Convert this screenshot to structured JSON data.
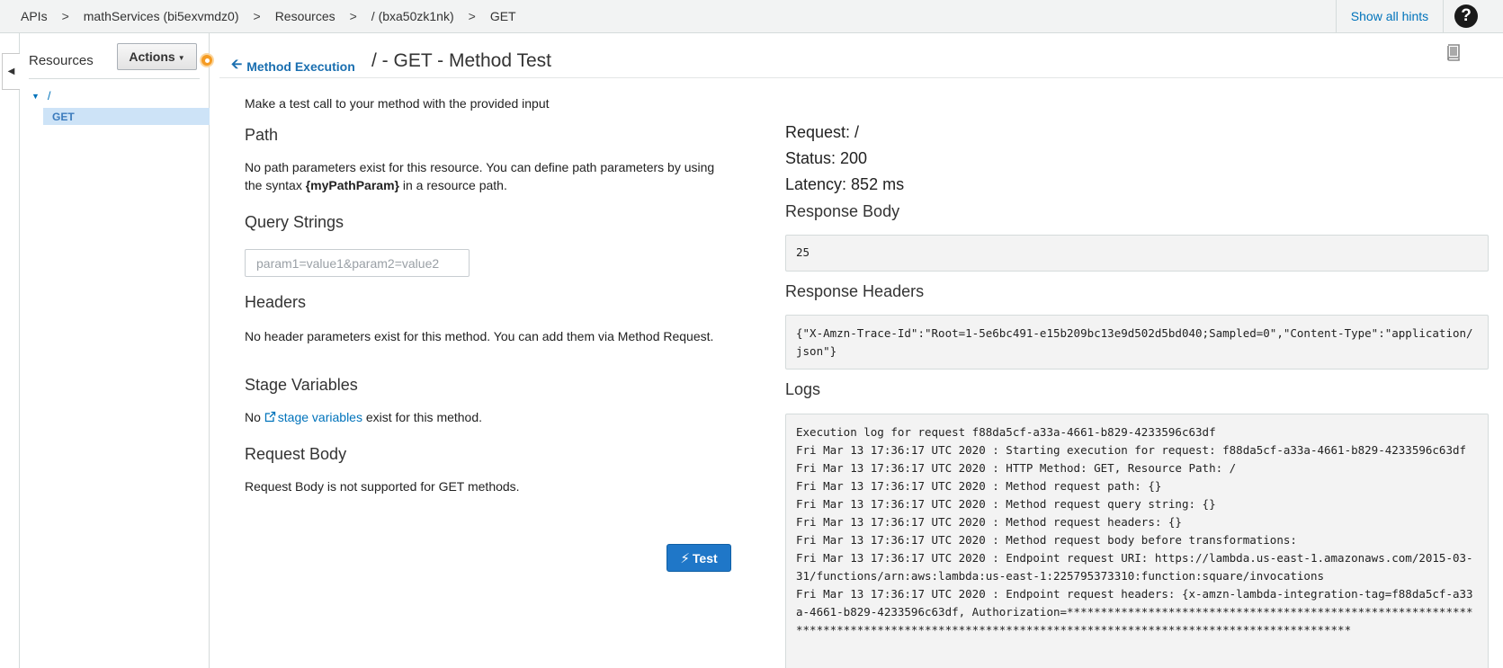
{
  "breadcrumb": {
    "items": [
      "APIs",
      "mathServices (bi5exvmdz0)",
      "Resources",
      "/ (bxa50zk1nk)",
      "GET"
    ],
    "separator": ">"
  },
  "topbar": {
    "hints_label": "Show all hints",
    "help_glyph": "?"
  },
  "sidebar": {
    "title": "Resources",
    "actions_label": "Actions",
    "tree_root": "/",
    "tree_child": "GET"
  },
  "header": {
    "back_link": "Method Execution",
    "title": "/ - GET - Method Test"
  },
  "form": {
    "intro": "Make a test call to your method with the provided input",
    "path_heading": "Path",
    "path_text_before": "No path parameters exist for this resource. You can define path parameters by using the syntax ",
    "path_param_token": "{myPathParam}",
    "path_text_after": " in a resource path.",
    "query_heading": "Query Strings",
    "query_placeholder": "param1=value1&param2=value2",
    "query_value": "",
    "headers_heading": "Headers",
    "headers_text": "No header parameters exist for this method. You can add them via Method Request.",
    "stage_heading": "Stage Variables",
    "stage_prefix": "No ",
    "stage_link": "stage variables",
    "stage_suffix": " exist for this method.",
    "body_heading": "Request Body",
    "body_text": "Request Body is not supported for GET methods.",
    "test_label": "Test"
  },
  "response": {
    "request": "Request: /",
    "status": "Status: 200",
    "latency": "Latency: 852 ms",
    "body_heading": "Response Body",
    "body": "25",
    "headers_heading": "Response Headers",
    "headers": "{\"X-Amzn-Trace-Id\":\"Root=1-5e6bc491-e15b209bc13e9d502d5bd040;Sampled=0\",\"Content-Type\":\"application/json\"}",
    "logs_heading": "Logs",
    "logs": "Execution log for request f88da5cf-a33a-4661-b829-4233596c63df\nFri Mar 13 17:36:17 UTC 2020 : Starting execution for request: f88da5cf-a33a-4661-b829-4233596c63df\nFri Mar 13 17:36:17 UTC 2020 : HTTP Method: GET, Resource Path: /\nFri Mar 13 17:36:17 UTC 2020 : Method request path: {}\nFri Mar 13 17:36:17 UTC 2020 : Method request query string: {}\nFri Mar 13 17:36:17 UTC 2020 : Method request headers: {}\nFri Mar 13 17:36:17 UTC 2020 : Method request body before transformations:\nFri Mar 13 17:36:17 UTC 2020 : Endpoint request URI: https://lambda.us-east-1.amazonaws.com/2015-03-31/functions/arn:aws:lambda:us-east-1:225795373310:function:square/invocations\nFri Mar 13 17:36:17 UTC 2020 : Endpoint request headers: {x-amzn-lambda-integration-tag=f88da5cf-a33a-4661-b829-4233596c63df, Authorization=**********************************************************************************************************************************************"
  },
  "colors": {
    "link": "#0073bb",
    "primary_button": "#1f77c8",
    "selected_tree": "#cde3f7",
    "accent_dot": "#f59b22"
  },
  "icons": [
    "caret-left-icon",
    "caret-down-icon",
    "arrow-left-icon",
    "book-icon",
    "external-link-icon",
    "bolt-icon",
    "help-icon"
  ]
}
